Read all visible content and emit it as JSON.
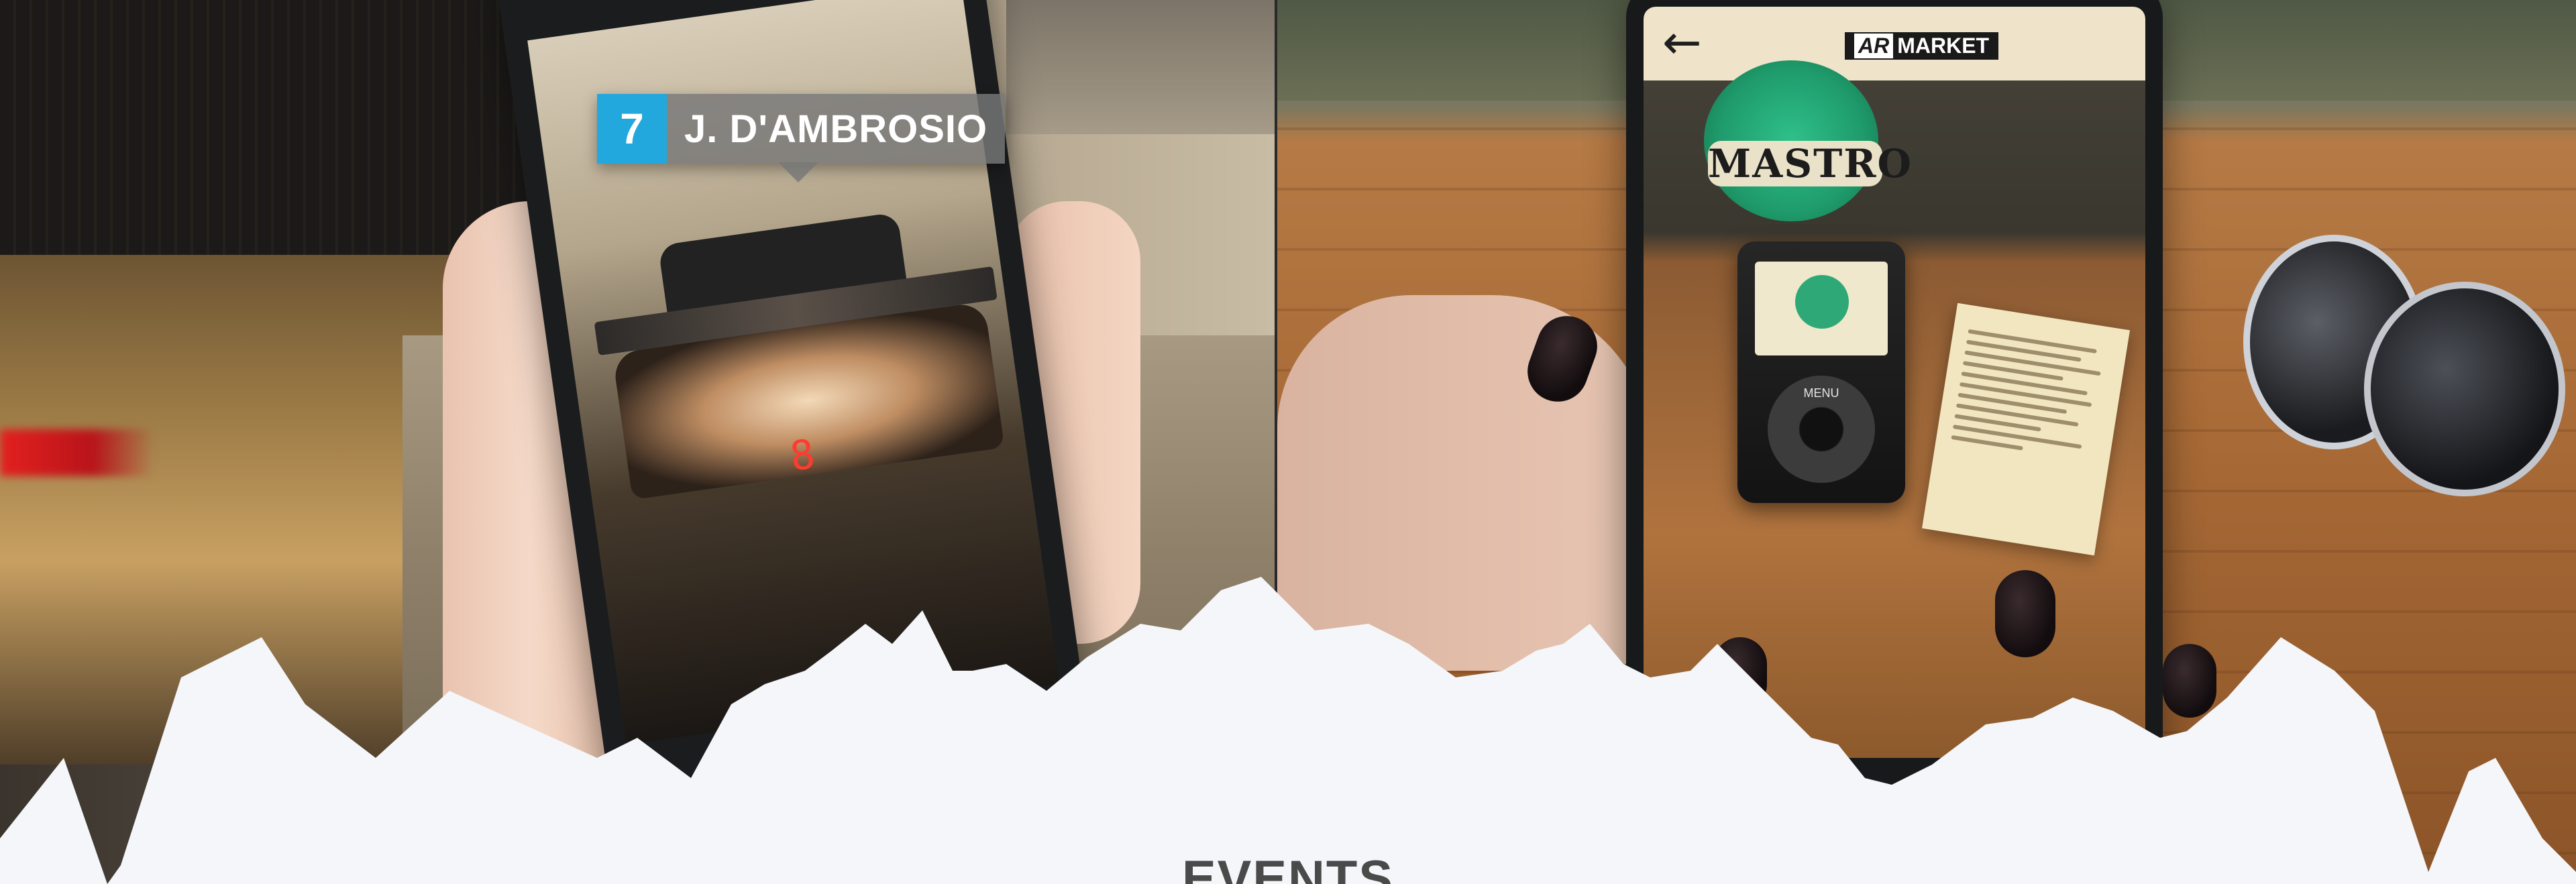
{
  "left_panel": {
    "driver_tag": {
      "number": "7",
      "name": "J. D'AMBROSIO",
      "number_color": "#23a8de"
    },
    "car_number": "8"
  },
  "right_panel": {
    "app_header": {
      "back_icon": "arrow-left-icon",
      "logo_mark": "AR",
      "logo_text": "MARKET"
    },
    "badge_text": "MASTRO",
    "ipod_menu_label": "MENU"
  },
  "section": {
    "title": "EVENTS",
    "background_color": "#f4f6fa"
  }
}
